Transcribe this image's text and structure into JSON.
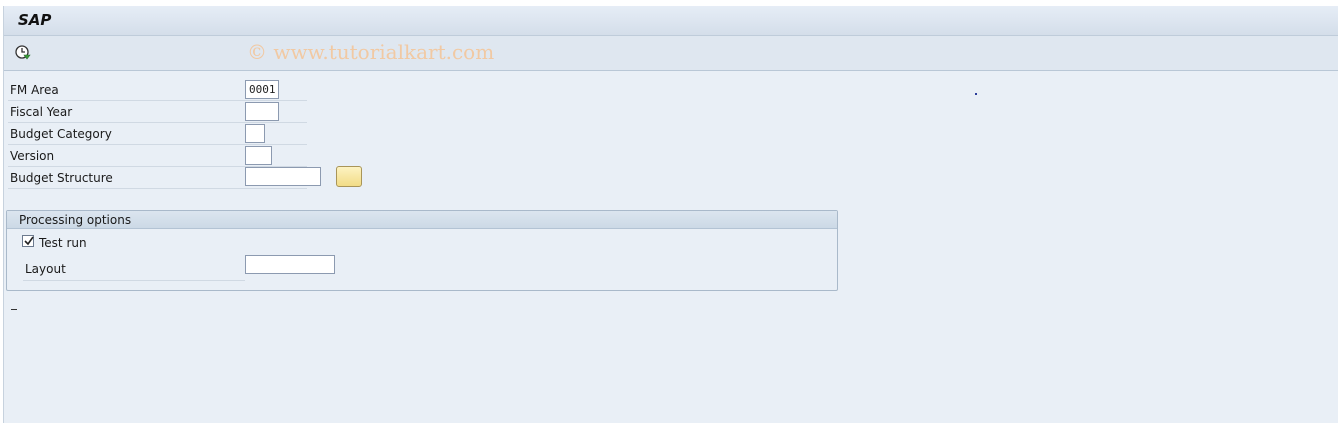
{
  "window": {
    "title": "SAP"
  },
  "toolbar": {
    "execute_icon": "execute-clock-icon"
  },
  "watermark": "© www.tutorialkart.com",
  "fields": {
    "fm_area": {
      "label": "FM Area",
      "value": "0001"
    },
    "fiscal_year": {
      "label": "Fiscal Year",
      "value": ""
    },
    "budget_category": {
      "label": "Budget Category",
      "value": ""
    },
    "version": {
      "label": "Version",
      "value": ""
    },
    "budget_structure": {
      "label": "Budget Structure",
      "value": ""
    }
  },
  "processing_options": {
    "title": "Processing options",
    "test_run": {
      "label": "Test run",
      "checked": true
    },
    "layout": {
      "label": "Layout",
      "value": ""
    }
  },
  "colors": {
    "background": "#e9eff6",
    "toolbar": "#dfe7f0",
    "watermark": "#f1c9a3",
    "button_yellow": "#f2dc86"
  }
}
